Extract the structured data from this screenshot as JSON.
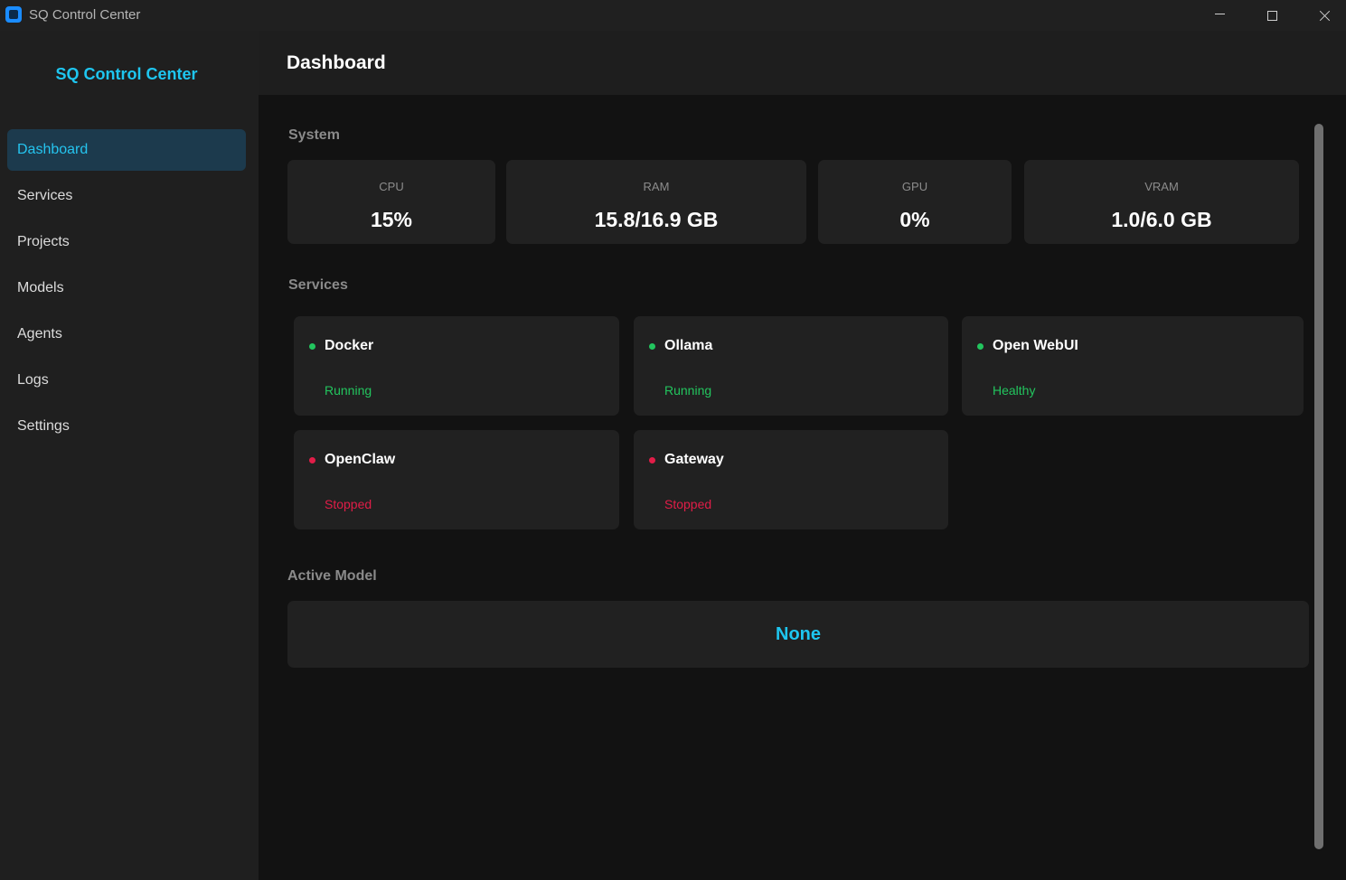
{
  "window": {
    "title": "SQ Control Center"
  },
  "sidebar": {
    "brand": "SQ Control Center",
    "items": [
      {
        "label": "Dashboard",
        "active": true
      },
      {
        "label": "Services",
        "active": false
      },
      {
        "label": "Projects",
        "active": false
      },
      {
        "label": "Models",
        "active": false
      },
      {
        "label": "Agents",
        "active": false
      },
      {
        "label": "Logs",
        "active": false
      },
      {
        "label": "Settings",
        "active": false
      }
    ]
  },
  "header": {
    "title": "Dashboard"
  },
  "system": {
    "label": "System",
    "stats": [
      {
        "label": "CPU",
        "value": "15%"
      },
      {
        "label": "RAM",
        "value": "15.8/16.9 GB"
      },
      {
        "label": "GPU",
        "value": "0%"
      },
      {
        "label": "VRAM",
        "value": "1.0/6.0 GB"
      }
    ]
  },
  "services": {
    "label": "Services",
    "items": [
      {
        "name": "Docker",
        "status": "Running",
        "status_color": "#22c55e"
      },
      {
        "name": "Ollama",
        "status": "Running",
        "status_color": "#22c55e"
      },
      {
        "name": "Open WebUI",
        "status": "Healthy",
        "status_color": "#22c55e"
      },
      {
        "name": "OpenClaw",
        "status": "Stopped",
        "status_color": "#e11d48"
      },
      {
        "name": "Gateway",
        "status": "Stopped",
        "status_color": "#e11d48"
      }
    ]
  },
  "active_model": {
    "label": "Active Model",
    "value": "None",
    "value_color": "#1ec6f0"
  },
  "colors": {
    "accent": "#1ec6f0",
    "running": "#22c55e",
    "stopped": "#e11d48"
  }
}
